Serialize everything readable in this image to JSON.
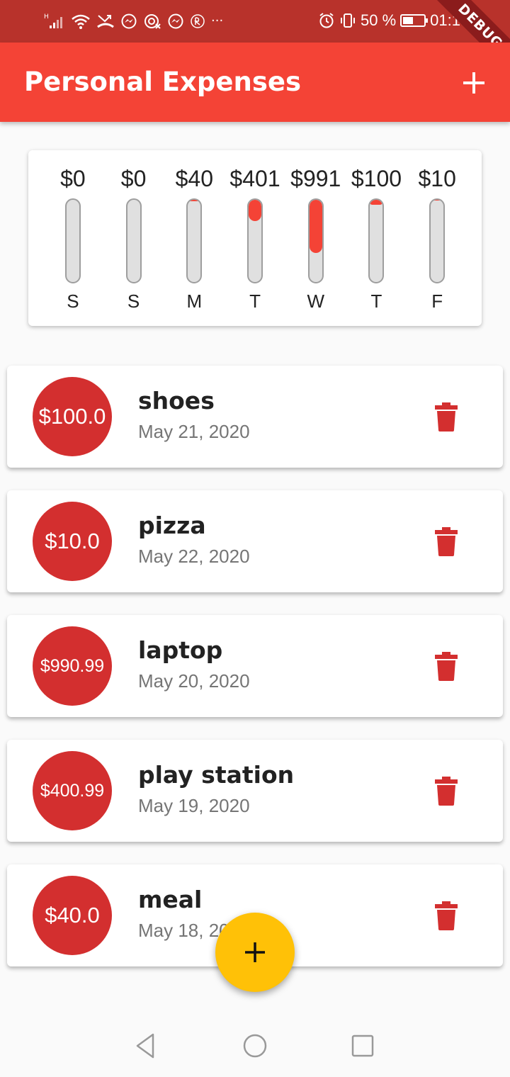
{
  "status_bar": {
    "left_icons": [
      "signal-icon",
      "wifi-icon",
      "missed-call-icon",
      "messenger-icon",
      "hotspot-icon",
      "messenger-icon",
      "app-icon",
      "more-icon"
    ],
    "more_text": "···",
    "battery_percent": "50 %",
    "battery_level": 0.5,
    "time": "01:1",
    "debug_label": "DEBUG"
  },
  "appbar": {
    "title": "Personal Expenses",
    "add_label": "+"
  },
  "chart_data": {
    "type": "bar",
    "categories": [
      "S",
      "S",
      "M",
      "T",
      "W",
      "T",
      "F"
    ],
    "amount_labels": [
      "$0",
      "$0",
      "$40",
      "$401",
      "$991",
      "$100",
      "$10"
    ],
    "values": [
      0,
      0,
      40,
      401,
      991,
      100,
      10
    ],
    "fill_fraction": [
      0,
      0,
      0.02,
      0.26,
      0.65,
      0.06,
      0.01
    ],
    "bar_color": "#f44336",
    "track_color": "#e0e0e0"
  },
  "transactions": [
    {
      "amount": "$100.0",
      "title": "shoes",
      "date": "May 21, 2020"
    },
    {
      "amount": "$10.0",
      "title": "pizza",
      "date": "May 22, 2020"
    },
    {
      "amount": "$990.99",
      "title": "laptop",
      "date": "May 20, 2020"
    },
    {
      "amount": "$400.99",
      "title": "play station",
      "date": "May 19, 2020"
    },
    {
      "amount": "$40.0",
      "title": "meal",
      "date": "May 18, 2020"
    }
  ],
  "fab": {
    "label": "+"
  },
  "colors": {
    "primary": "#f44336",
    "status_bar": "#b8322b",
    "avatar": "#d32f2f",
    "delete_icon": "#d32f2f",
    "fab": "#ffc107"
  }
}
